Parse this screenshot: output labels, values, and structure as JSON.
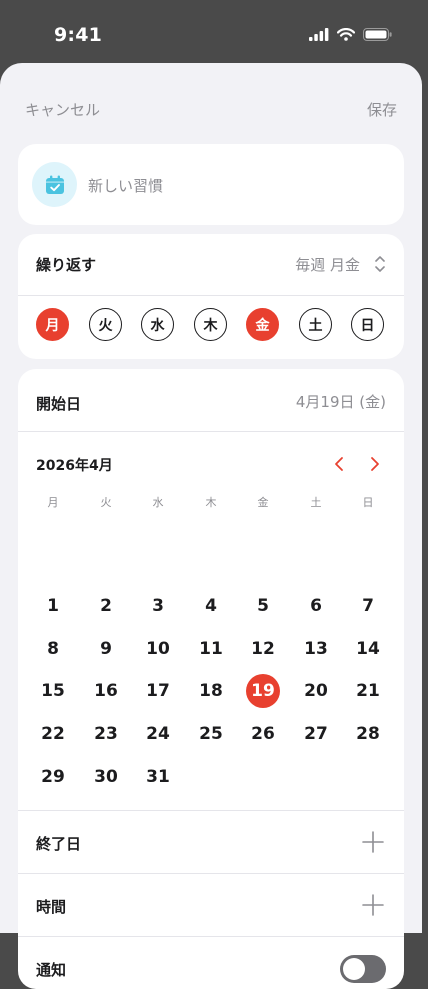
{
  "status_bar": {
    "time": "9:41"
  },
  "nav": {
    "cancel": "キャンセル",
    "save": "保存"
  },
  "habit": {
    "name_placeholder": "新しい習慣",
    "icon": "calendar-check-icon",
    "icon_color": "#4ac3e0"
  },
  "repeat": {
    "label": "繰り返す",
    "value": "毎週 月金",
    "weekdays": [
      {
        "label": "月",
        "selected": true
      },
      {
        "label": "火",
        "selected": false
      },
      {
        "label": "水",
        "selected": false
      },
      {
        "label": "木",
        "selected": false
      },
      {
        "label": "金",
        "selected": true
      },
      {
        "label": "土",
        "selected": false
      },
      {
        "label": "日",
        "selected": false
      }
    ]
  },
  "start": {
    "label": "開始日",
    "value": "4月19日 (金)",
    "calendar": {
      "month_title": "2026年4月",
      "weekday_headers": [
        "月",
        "火",
        "水",
        "木",
        "金",
        "土",
        "日"
      ],
      "weeks": [
        [
          "1",
          "2",
          "3",
          "4",
          "5",
          "6",
          "7"
        ],
        [
          "8",
          "9",
          "10",
          "11",
          "12",
          "13",
          "14"
        ],
        [
          "15",
          "16",
          "17",
          "18",
          "19",
          "20",
          "21"
        ],
        [
          "22",
          "23",
          "24",
          "25",
          "26",
          "27",
          "28"
        ],
        [
          "29",
          "30",
          "31",
          "",
          "",
          "",
          ""
        ]
      ],
      "selected_day": "19"
    }
  },
  "end": {
    "label": "終了日"
  },
  "time": {
    "label": "時間"
  },
  "notify": {
    "label": "通知",
    "enabled": false
  },
  "colors": {
    "accent": "#e8402f",
    "muted": "#8e8e93",
    "background": "#f2f2f6"
  }
}
